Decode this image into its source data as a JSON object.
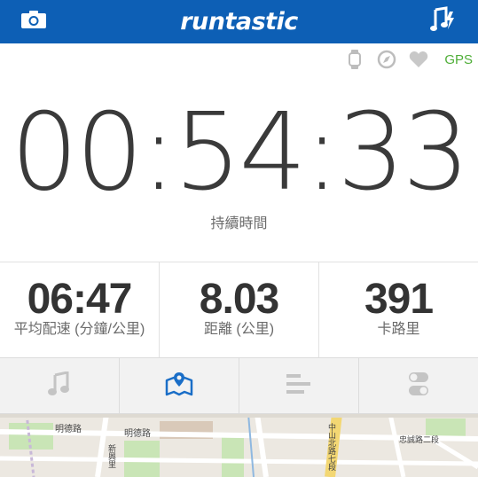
{
  "header": {
    "brand": "runtastic",
    "left_icon": "camera-icon",
    "right_icon": "music-note-flash-icon",
    "bg_color": "#0d5fb5"
  },
  "status": {
    "icons": [
      "watch-icon",
      "compass-icon",
      "heart-icon"
    ],
    "gps_label": "GPS",
    "gps_color": "#4fae38"
  },
  "timer": {
    "value": "00:54:33",
    "label": "持續時間"
  },
  "stats": [
    {
      "value": "06:47",
      "label": "平均配速 (分鐘/公里)"
    },
    {
      "value": "8.03",
      "label": "距離 (公里)"
    },
    {
      "value": "391",
      "label": "卡路里"
    }
  ],
  "tabs": [
    {
      "icon": "music-icon",
      "active": false
    },
    {
      "icon": "map-icon",
      "active": true
    },
    {
      "icon": "bar-chart-icon",
      "active": false
    },
    {
      "icon": "toggle-icon",
      "active": false
    }
  ],
  "map": {
    "labels": [
      "明德路",
      "明德路",
      "新興里",
      "中山北路七段",
      "忠誠路二段"
    ]
  }
}
